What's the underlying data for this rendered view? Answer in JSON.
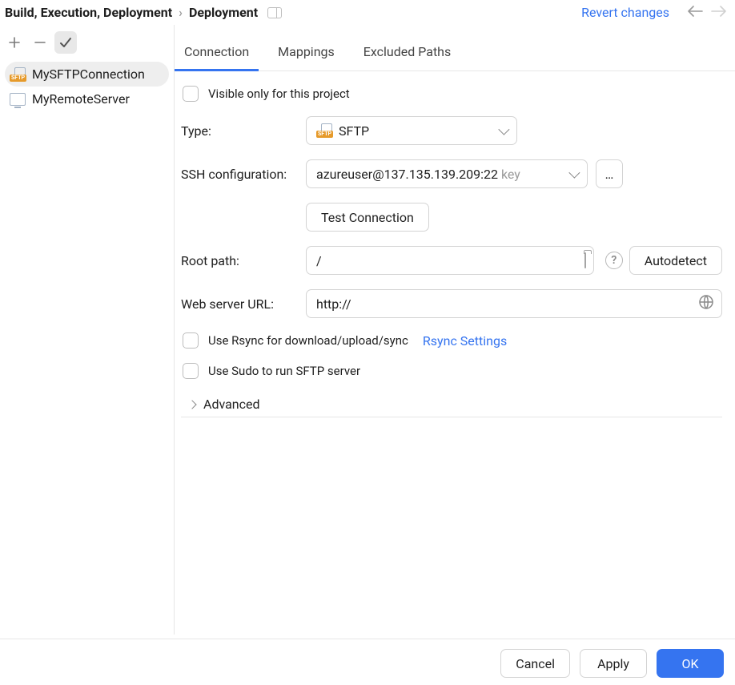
{
  "breadcrumb": {
    "group": "Build, Execution, Deployment",
    "page": "Deployment"
  },
  "header": {
    "revert": "Revert changes"
  },
  "sidebar": {
    "items": [
      {
        "label": "MySFTPConnection",
        "icon": "sftp-icon",
        "selected": true
      },
      {
        "label": "MyRemoteServer",
        "icon": "host-icon",
        "selected": false
      }
    ]
  },
  "tabs": [
    "Connection",
    "Mappings",
    "Excluded Paths"
  ],
  "active_tab": 0,
  "form": {
    "visible_only": {
      "label": "Visible only for this project",
      "checked": false
    },
    "type": {
      "label": "Type:",
      "value": "SFTP"
    },
    "ssh": {
      "label": "SSH configuration:",
      "value": "azureuser@137.135.139.209:22",
      "suffix": "key",
      "more": "…"
    },
    "test": {
      "label": "Test Connection"
    },
    "root": {
      "label": "Root path:",
      "value": "/",
      "autodetect": "Autodetect"
    },
    "web": {
      "label": "Web server URL:",
      "value": "http://"
    },
    "rsync": {
      "label": "Use Rsync for download/upload/sync",
      "checked": false,
      "settings": "Rsync Settings"
    },
    "sudo": {
      "label": "Use Sudo to run SFTP server",
      "checked": false
    },
    "advanced": "Advanced"
  },
  "footer": {
    "cancel": "Cancel",
    "apply": "Apply",
    "ok": "OK"
  }
}
